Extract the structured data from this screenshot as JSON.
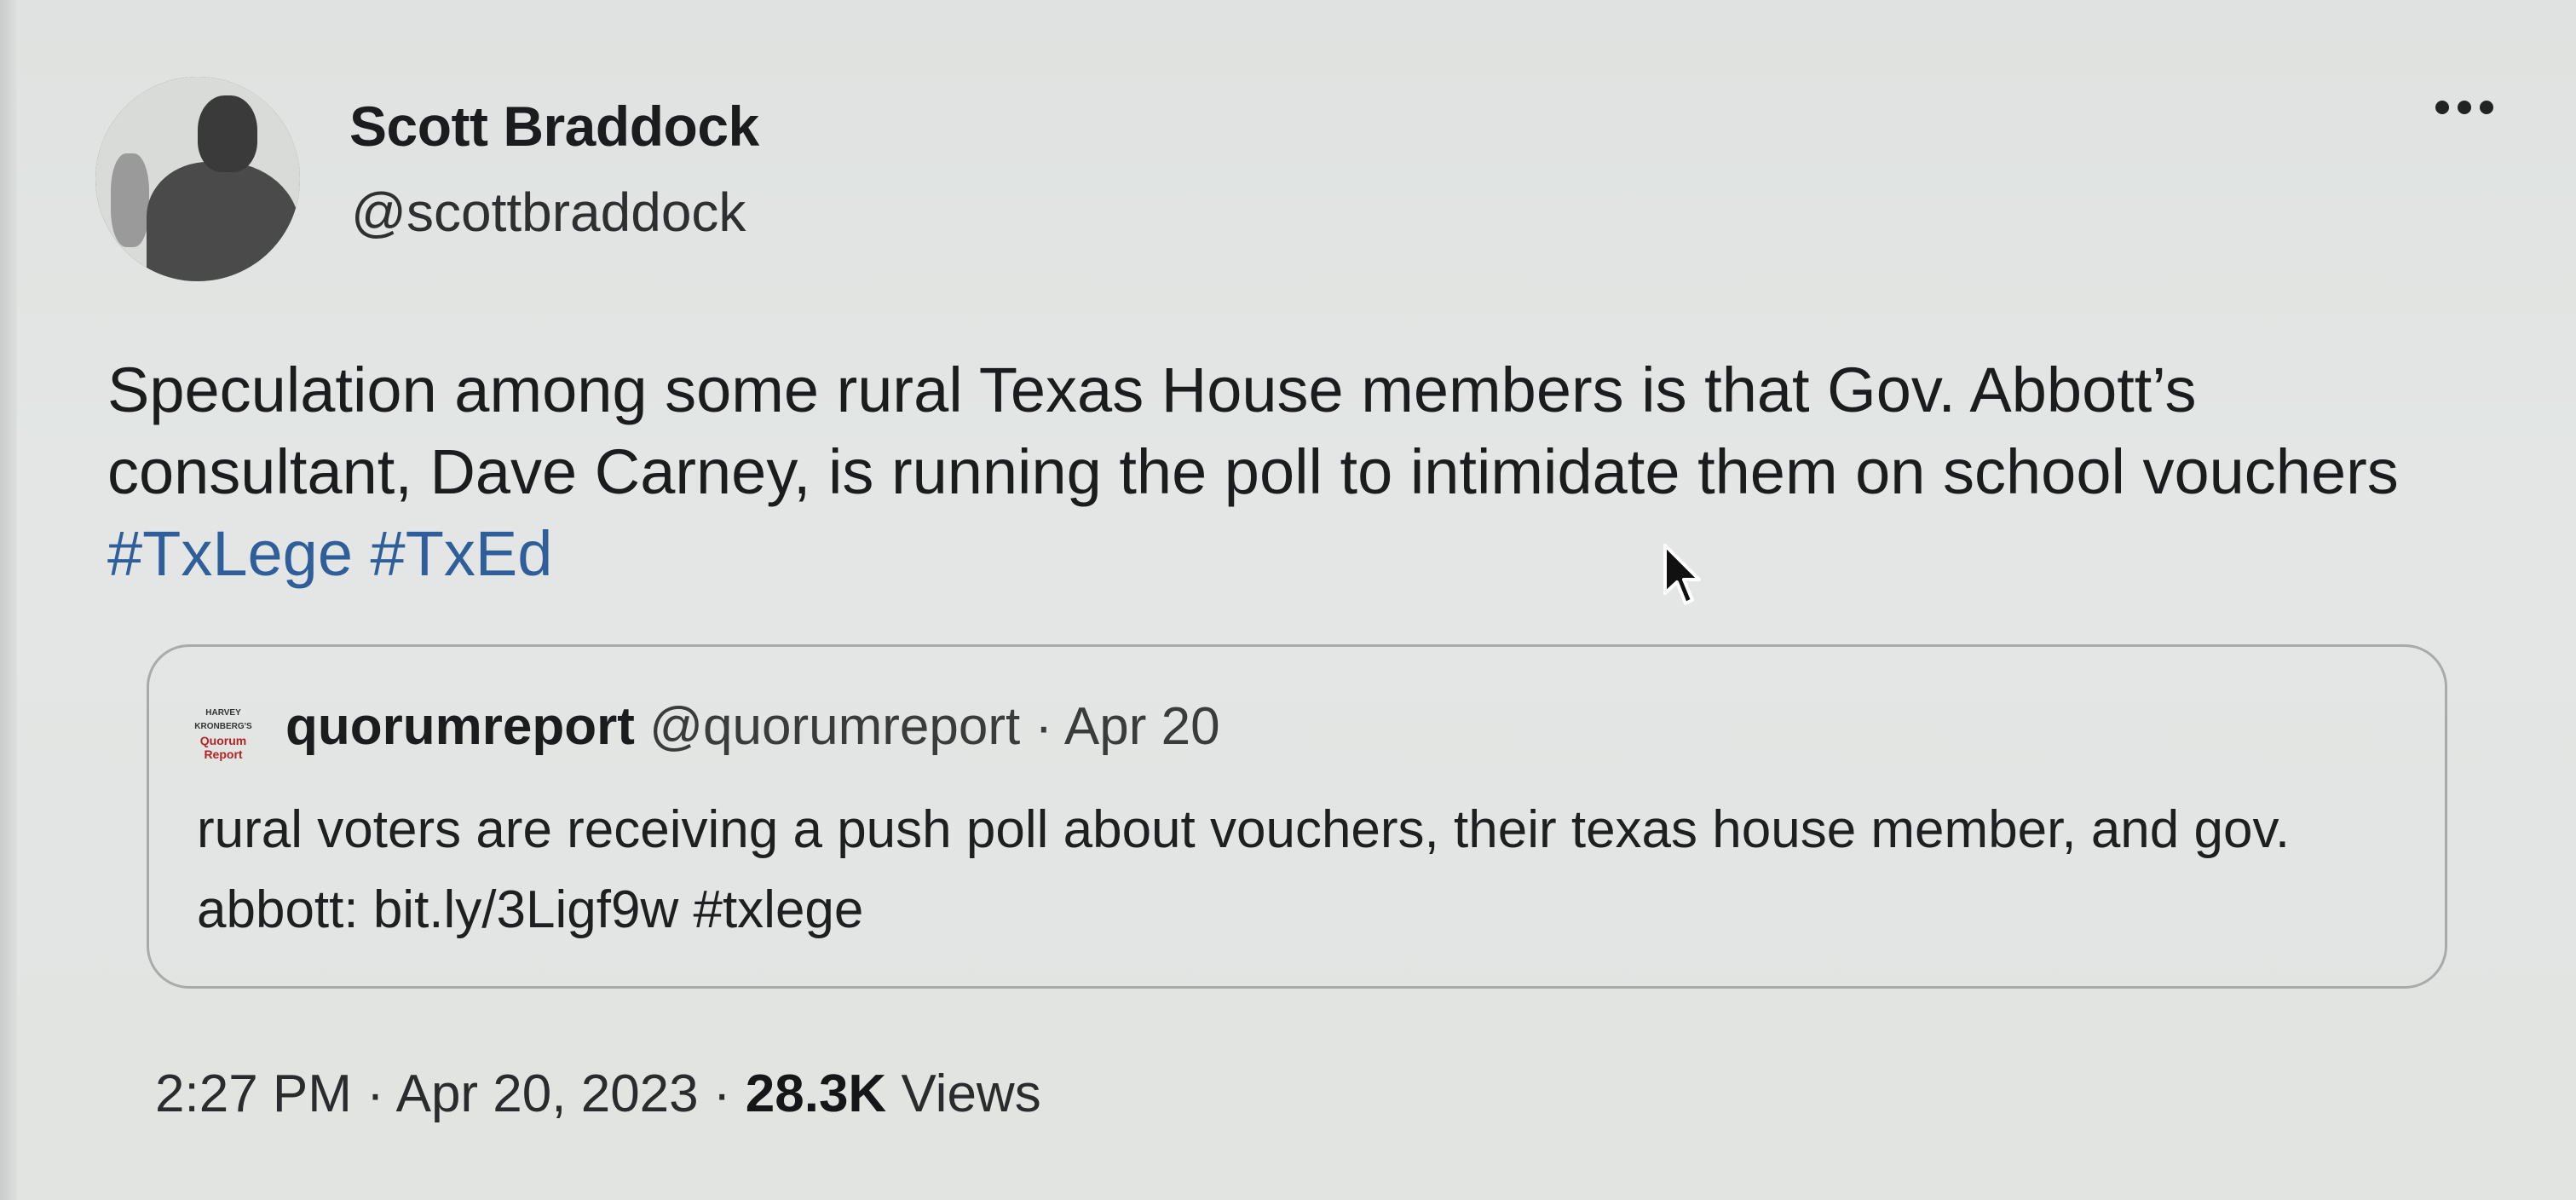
{
  "author": {
    "name": "Scott Braddock",
    "handle": "@scottbraddock"
  },
  "tweet": {
    "text": "Speculation among some rural Texas House members is that Gov. Abbott’s consultant, Dave Carney, is running the poll to intimidate them on school vouchers",
    "hashtags": [
      "#TxLege",
      "#TxEd"
    ]
  },
  "quoted_tweet": {
    "logo_text": [
      "HARVEY",
      "KRONBERG'S",
      "Quorum",
      "Report"
    ],
    "name": "quorumreport",
    "handle": "@quorumreport",
    "separator": " · ",
    "date": "Apr 20",
    "text": "rural voters are receiving a push poll about vouchers, their texas house member, and gov. abbott: bit.ly/3Ligf9w #txlege"
  },
  "footer": {
    "time": "2:27 PM",
    "date": "Apr 20, 2023",
    "views_count": "28.3K",
    "views_label": "Views",
    "separator": " · "
  },
  "icons": {
    "more": "more-dots-icon",
    "cursor": "mouse-pointer-icon"
  },
  "colors": {
    "background": "#e2e4e2",
    "hashtag": "#2f5f9a",
    "text": "#1b1c1d",
    "quote_border": "#a8abaa"
  }
}
